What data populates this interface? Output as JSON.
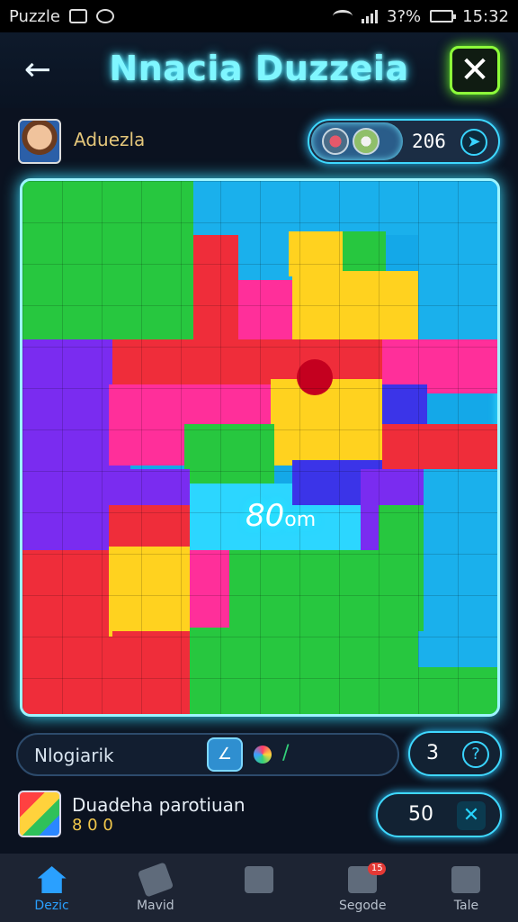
{
  "status_bar": {
    "app_name": "Puzzle",
    "battery": "3?%",
    "time": "15:32"
  },
  "header": {
    "title": "Nnacia Duzzeia",
    "back_icon": "arrow-left-icon",
    "close_icon": "close-icon"
  },
  "player": {
    "name": "Aduezla",
    "score": "206"
  },
  "board": {
    "center_label": "80",
    "center_suffix": "om"
  },
  "toolbar": {
    "label": "Nlogiarik",
    "hint_count": "3"
  },
  "achievement": {
    "title": "Duadeha parotiuan",
    "subtitle": "8 0 0",
    "coins": "50"
  },
  "bottom_nav": [
    {
      "label": "Dezic",
      "icon": "home-icon",
      "active": true
    },
    {
      "label": "Mavid",
      "icon": "tag-icon",
      "active": false
    },
    {
      "label": "",
      "icon": "house-arrow-icon",
      "active": false
    },
    {
      "label": "Segode",
      "icon": "mail-icon",
      "active": false,
      "badge": "15"
    },
    {
      "label": "Tale",
      "icon": "grid-icon",
      "active": false
    }
  ]
}
